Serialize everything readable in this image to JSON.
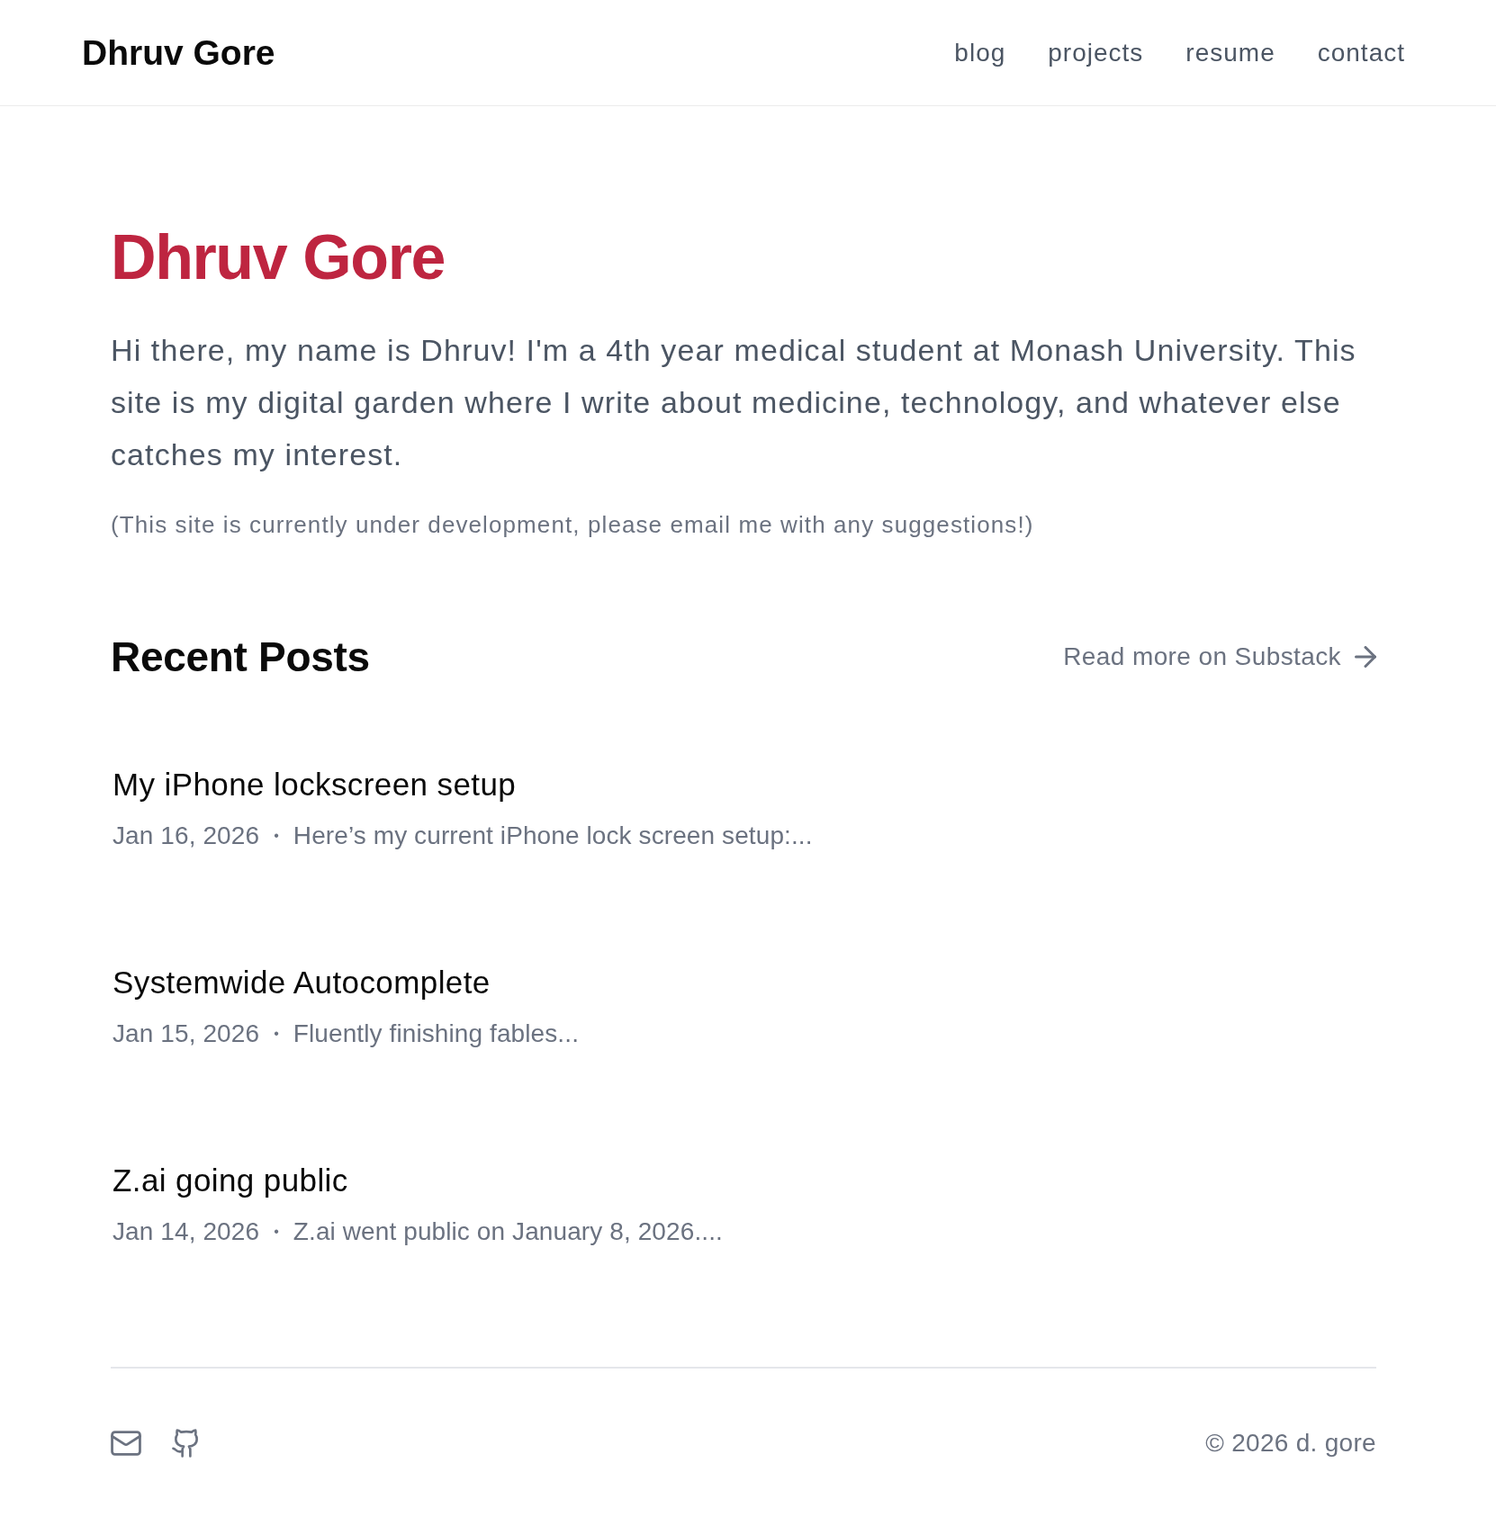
{
  "header": {
    "logo": "Dhruv Gore",
    "nav": [
      {
        "label": "blog"
      },
      {
        "label": "projects"
      },
      {
        "label": "resume"
      },
      {
        "label": "contact"
      }
    ]
  },
  "hero": {
    "title": "Dhruv Gore",
    "intro": "Hi there, my name is Dhruv! I'm a 4th year medical student at Monash University. This site is my digital garden where I write about medicine, technology, and whatever else catches my interest.",
    "note": "(This site is currently under development, please email me with any suggestions!)"
  },
  "recent_posts": {
    "heading": "Recent Posts",
    "more_link": "Read more on Substack",
    "posts": [
      {
        "title": "My iPhone lockscreen setup",
        "date": "Jan 16, 2026",
        "separator": "•",
        "excerpt": "Here’s my current iPhone lock screen setup:..."
      },
      {
        "title": "Systemwide Autocomplete",
        "date": "Jan 15, 2026",
        "separator": "•",
        "excerpt": "Fluently finishing fables..."
      },
      {
        "title": "Z.ai going public",
        "date": "Jan 14, 2026",
        "separator": "•",
        "excerpt": "Z.ai went public on January 8, 2026...."
      }
    ]
  },
  "footer": {
    "copyright": "© 2026 d. gore"
  }
}
